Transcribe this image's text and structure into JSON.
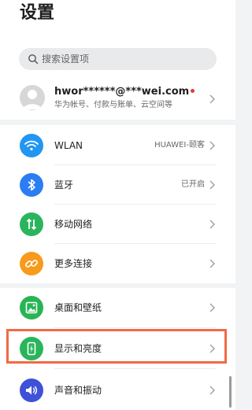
{
  "page_title": "设置",
  "search": {
    "placeholder": "搜索设置项"
  },
  "account": {
    "name": "hwor******@***wei.com",
    "subtitle": "华为帐号、付款与账单、云空间等",
    "badge_color": "#e53935"
  },
  "items": [
    {
      "label": "WLAN",
      "value": "HUAWEI-颐客",
      "icon": "wifi-icon",
      "color": "#2196f3"
    },
    {
      "label": "蓝牙",
      "value": "已开启",
      "icon": "bluetooth-icon",
      "color": "#2a7df2"
    },
    {
      "label": "移动网络",
      "icon": "mobile-network-icon",
      "color": "#2ab55c"
    },
    {
      "label": "更多连接",
      "icon": "link-icon",
      "color": "#f89a1c"
    },
    {
      "label": "桌面和壁纸",
      "icon": "wallpaper-icon",
      "color": "#28b455"
    },
    {
      "label": "显示和亮度",
      "icon": "display-brightness-icon",
      "color": "#2ab55c"
    },
    {
      "label": "声音和振动",
      "icon": "sound-icon",
      "color": "#3f51d8"
    }
  ],
  "highlight_color": "#f06b45"
}
